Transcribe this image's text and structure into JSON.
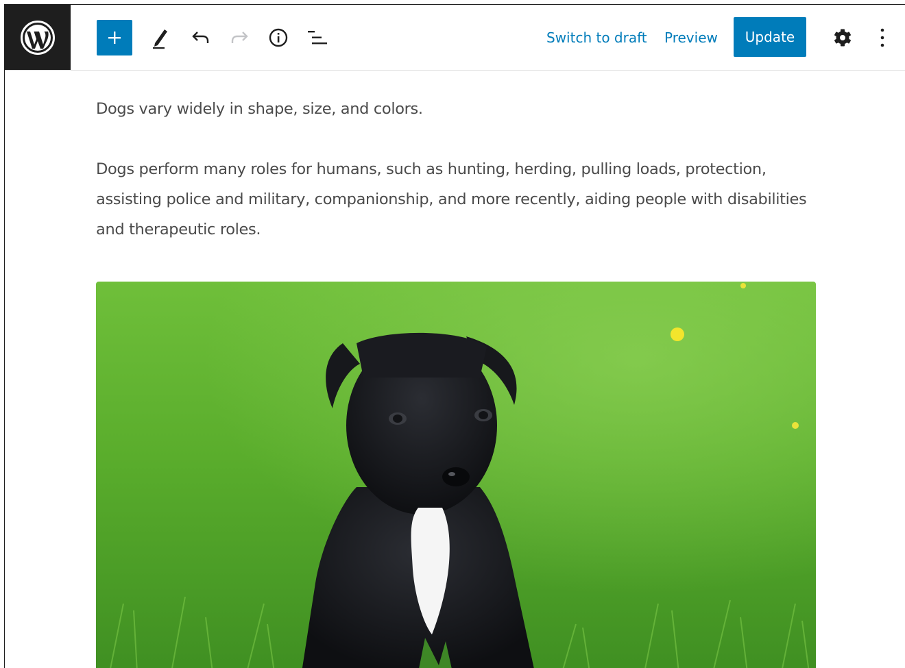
{
  "app": {
    "logo": "wordpress-logo"
  },
  "toolbar": {
    "icons": {
      "inserter": "plus-icon",
      "edit": "pencil-icon",
      "undo": "undo-icon",
      "redo": "redo-icon",
      "info": "info-icon",
      "list_view": "list-view-icon",
      "settings": "gear-icon",
      "more": "more-vertical-icon"
    },
    "switch_to_draft_label": "Switch to draft",
    "preview_label": "Preview",
    "update_label": "Update"
  },
  "colors": {
    "accent": "#007cba",
    "logo_bg": "#1e1e1e",
    "text": "#4b4b4b",
    "redo_disabled": "#c3c4c7"
  },
  "post": {
    "paragraphs": [
      "Dogs vary widely in shape, size, and colors.",
      "Dogs perform many roles for humans, such as hunting, herding, pulling loads, protection, assisting police and military, companionship, and more recently, aiding people with disabilities and therapeutic roles."
    ],
    "image": {
      "subject": "black-puppy-in-grass"
    }
  }
}
